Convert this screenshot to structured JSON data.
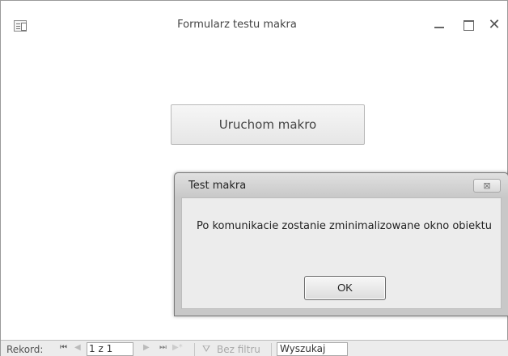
{
  "window": {
    "title": "Formularz testu makra",
    "minimize": "–",
    "maximize": "□",
    "close": "✕"
  },
  "form": {
    "run_macro_label": "Uruchom makro"
  },
  "dialog": {
    "title": "Test makra",
    "close_icon": "⊠",
    "message": "Po komunikacie zostanie zminimalizowane okno obiektu",
    "ok_label": "OK"
  },
  "navigation": {
    "record_label": "Rekord:",
    "first": "⏮",
    "prev": "◀",
    "record_value": "1 z 1",
    "next": "▶",
    "last": "⏭",
    "new": "▶*",
    "filter_label": "Bez filtru",
    "search_value": "Wyszukaj"
  }
}
